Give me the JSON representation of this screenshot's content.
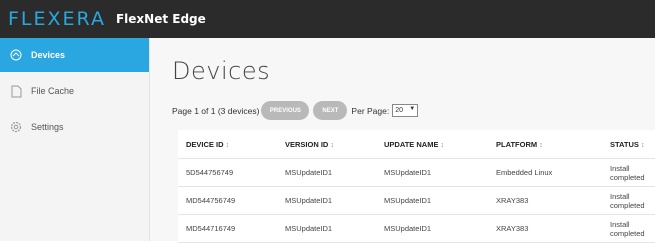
{
  "header": {
    "logo": "FLEXERA",
    "product": "FlexNet Edge"
  },
  "sidebar": {
    "items": [
      {
        "label": "Devices",
        "icon": "devices-icon",
        "active": true
      },
      {
        "label": "File Cache",
        "icon": "file-icon",
        "active": false
      },
      {
        "label": "Settings",
        "icon": "gear-icon",
        "active": false
      }
    ]
  },
  "main": {
    "title": "Devices",
    "pager": {
      "text": "Page 1 of 1 (3 devices)",
      "previous": "PREVIOUS",
      "next": "NEXT",
      "per_page_label": "Per Page:",
      "per_page_value": "20"
    },
    "table": {
      "columns": [
        "DEVICE ID",
        "VERSION ID",
        "UPDATE NAME",
        "PLATFORM",
        "STATUS"
      ],
      "sort_glyph": "↕",
      "rows": [
        [
          "5D544756749",
          "MSUpdateID1",
          "MSUpdateID1",
          "Embedded Linux",
          "Install completed"
        ],
        [
          "MD544756749",
          "MSUpdateID1",
          "MSUpdateID1",
          "XRAY383",
          "Install completed"
        ],
        [
          "MD544716749",
          "MSUpdateID1",
          "MSUpdateID1",
          "XRAY383",
          "Install completed"
        ]
      ]
    }
  },
  "colors": {
    "topbar": "#2b2b2b",
    "accent": "#2aa6e0",
    "button": "#b9b9b9"
  }
}
